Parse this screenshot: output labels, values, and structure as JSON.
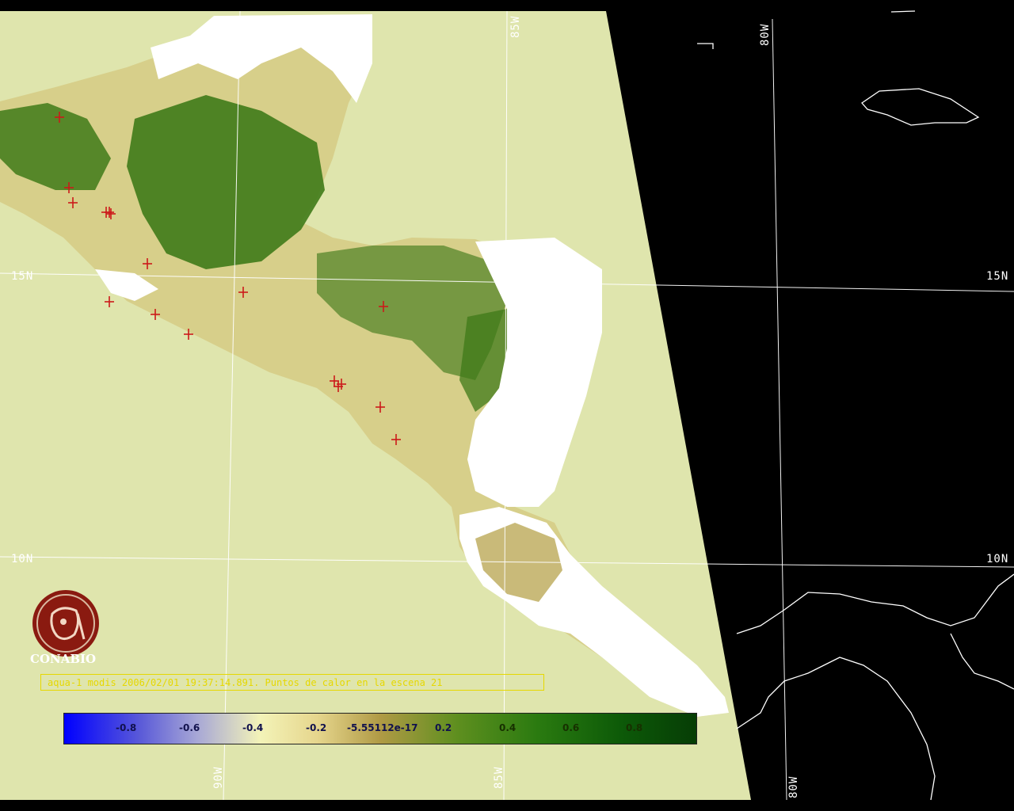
{
  "map": {
    "title_caption": "aqua-1 modis 2006/02/01 19:37:14.891. Puntos de calor en la escena 21",
    "latitude_labels": {
      "lat15_left": "15N",
      "lat15_right": "15N",
      "lat10_left": "10N",
      "lat10_right": "10N"
    },
    "longitude_labels": {
      "lon85_top": "85W",
      "lon80_top": "80W",
      "lon90_bottom": "90W",
      "lon85_bottom": "85W",
      "lon80_bottom": "80W"
    },
    "hotspot_count": 17,
    "colors": {
      "sea": "#dfe5ad",
      "cloud": "#ffffff",
      "outside_scene": "#000000",
      "hotspot": "#cc1a1a",
      "caption": "#e6d800",
      "logo": "#8a1a10"
    }
  },
  "logo": {
    "name": "CONABIO"
  },
  "legend": {
    "ticks": [
      "-0.8",
      "-0.6",
      "-0.4",
      "-0.2",
      "-5.55112e-17",
      "0.2",
      "0.4",
      "0.6",
      "0.8"
    ],
    "colors": [
      "#0000ff",
      "#a7a7d6",
      "#f3f3b8",
      "#b09a45",
      "#2a7a10",
      "#063d05"
    ]
  }
}
